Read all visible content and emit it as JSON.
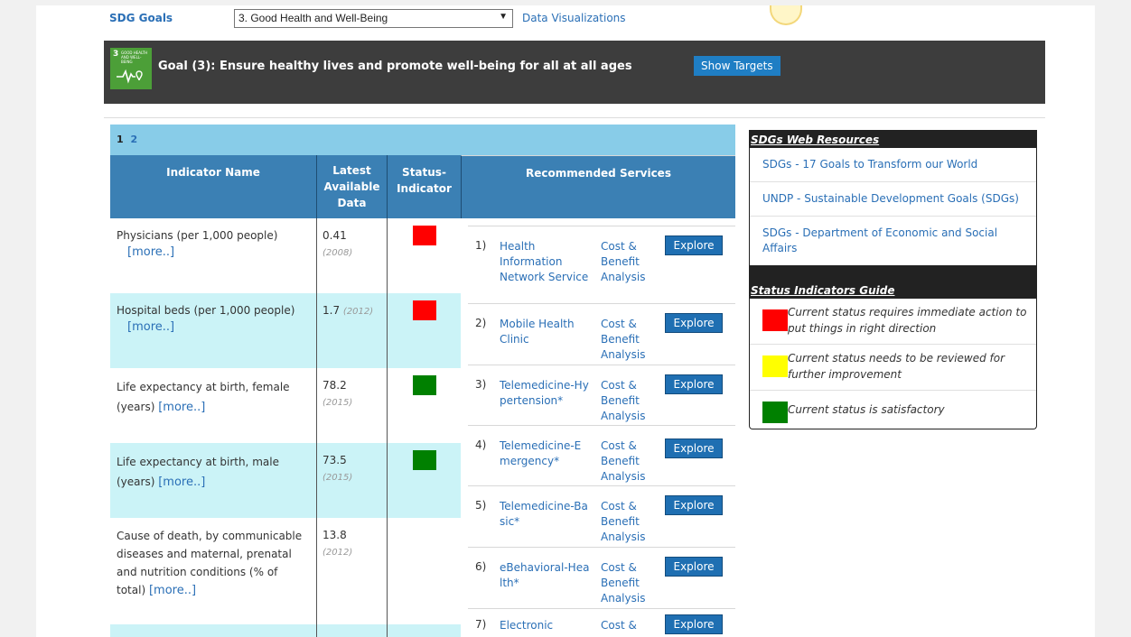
{
  "topbar": {
    "sdg_goals_label": "SDG Goals",
    "goal_selected": "3. Good Health and Well-Being",
    "data_viz_label": "Data Visualizations"
  },
  "banner": {
    "logo_number": "3",
    "logo_text": "GOOD HEALTH AND WELL-BEING",
    "goal_text": "Goal (3): Ensure healthy lives and promote well-being for all at all ages",
    "show_targets_label": "Show Targets"
  },
  "table": {
    "pages": [
      "1",
      "2"
    ],
    "headers": {
      "name": "Indicator Name",
      "data": "Latest Available Data",
      "status": "Status-Indicator",
      "services": "Recommended Services"
    },
    "more_label": "[more..]",
    "rows": [
      {
        "name": "Physicians (per 1,000 people)",
        "value": "0.41",
        "year": "(2008)",
        "status": "red"
      },
      {
        "name": "Hospital beds (per 1,000 people)",
        "value": "1.7",
        "year": "(2012)",
        "status": "red"
      },
      {
        "name": "Life expectancy at birth, female (years)",
        "value": "78.2",
        "year": "(2015)",
        "status": "green"
      },
      {
        "name": "Life expectancy at birth, male (years)",
        "value": "73.5",
        "year": "(2015)",
        "status": "green"
      },
      {
        "name": "Cause of death, by communicable diseases and maternal, prenatal and nutrition conditions (% of total)",
        "value": "13.8",
        "year": "(2012)",
        "status": "none"
      }
    ],
    "services": [
      {
        "index": "1)",
        "name": "Health Information Network Service",
        "cba": "Cost & Benefit Analysis",
        "button": "Explore"
      },
      {
        "index": "2)",
        "name": "Mobile Health Clinic",
        "cba": "Cost & Benefit Analysis",
        "button": "Explore"
      },
      {
        "index": "3)",
        "name": "Telemedicine-Hypertension*",
        "cba": "Cost & Benefit Analysis",
        "button": "Explore"
      },
      {
        "index": "4)",
        "name": "Telemedicine-Emergency*",
        "cba": "Cost & Benefit Analysis",
        "button": "Explore"
      },
      {
        "index": "5)",
        "name": "Telemedicine-Basic*",
        "cba": "Cost & Benefit Analysis",
        "button": "Explore"
      },
      {
        "index": "6)",
        "name": "eBehavioral-Health*",
        "cba": "Cost & Benefit Analysis",
        "button": "Explore"
      },
      {
        "index": "7)",
        "name": "Electronic",
        "cba": "Cost &",
        "button": "Explore"
      }
    ]
  },
  "sidebar": {
    "resources_title": "SDGs Web Resources",
    "resources": [
      "SDGs - 17 Goals to Transform our World",
      "UNDP - Sustainable Development Goals (SDGs)",
      "SDGs - Department of Economic and Social Affairs"
    ],
    "guide_title": "Status Indicators Guide",
    "guide": [
      {
        "color": "#ff0000",
        "text": "Current status requires immediate action to put things in right direction"
      },
      {
        "color": "#ffff00",
        "text": "Current status needs to be reviewed for further improvement"
      },
      {
        "color": "#008000",
        "text": "Current status is satisfactory"
      }
    ]
  },
  "colors": {
    "red": "#ff0000",
    "green": "#008000",
    "header_blue": "#3b80b4",
    "pager_blue": "#88cce8",
    "row_alt": "#cbf3f7"
  }
}
